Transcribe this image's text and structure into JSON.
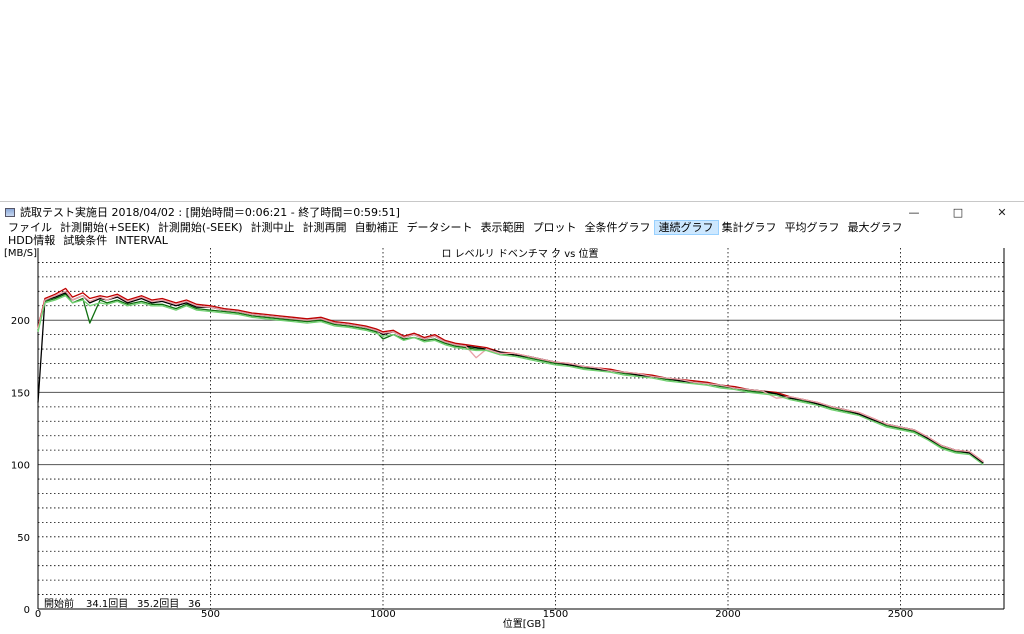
{
  "window": {
    "title": "読取テスト実施日 2018/04/02 : [開始時間＝0:06:21 - 終了時間＝0:59:51]",
    "controls": [
      "—",
      "□",
      "✕"
    ]
  },
  "icons": {
    "app": "app-window-icon",
    "minimize": "minimize-icon",
    "maximize": "maximize-icon",
    "close": "close-icon"
  },
  "menu": {
    "row1": [
      "ファイル",
      "計測開始(+SEEK)",
      "計測開始(-SEEK)",
      "計測中止",
      "計測再開",
      "自動補正",
      "データシート",
      "表示範囲",
      "プロット",
      "全条件グラフ",
      "連続グラフ",
      "集計グラフ",
      "平均グラフ",
      "最大グラフ"
    ],
    "row2": [
      "HDD情報",
      "試験条件",
      "INTERVAL"
    ],
    "active_index": 10
  },
  "colors": {
    "accent": "#cde8ff",
    "grid": "#000000"
  },
  "chart_data": {
    "type": "line",
    "title": "ロ  レベルリ  ドベンチマ  ク vs 位置",
    "xlabel": "位置[GB]",
    "ylabel": "[MB/S]",
    "xlim": [
      0,
      2800
    ],
    "ylim": [
      0,
      250
    ],
    "x_ticks": [
      0,
      500,
      1000,
      1500,
      2000,
      2500
    ],
    "y_ticks": [
      0,
      50,
      100,
      150,
      200
    ],
    "y_tick_labels": [
      "0",
      "50",
      "100",
      "150",
      "200"
    ],
    "x_tick_labels": [
      "0",
      "500",
      "1000",
      "1500",
      "2000",
      "2500"
    ],
    "legend": [
      "開始前",
      "34.1回目",
      "35.2回目",
      "36"
    ],
    "grid": true,
    "series": [
      {
        "color": "#c00000",
        "x": [
          0,
          20,
          50,
          80,
          100,
          130,
          150,
          180,
          200,
          230,
          260,
          300,
          330,
          360,
          400,
          430,
          460,
          500,
          540,
          580,
          620,
          660,
          700,
          740,
          780,
          820,
          860,
          900,
          950,
          980,
          1000,
          1030,
          1060,
          1090,
          1120,
          1150,
          1180,
          1210,
          1240,
          1270,
          1300,
          1340,
          1380,
          1420,
          1460,
          1500,
          1540,
          1580,
          1620,
          1660,
          1700,
          1740,
          1780,
          1820,
          1860,
          1900,
          1940,
          1980,
          2020,
          2060,
          2100,
          2140,
          2180,
          2220,
          2260,
          2300,
          2340,
          2380,
          2420,
          2460,
          2500,
          2540,
          2580,
          2620,
          2660,
          2700,
          2740
        ],
        "y": [
          195,
          215,
          218,
          222,
          216,
          219,
          215,
          217,
          216,
          218,
          214,
          217,
          214,
          215,
          212,
          214,
          211,
          210,
          208,
          207,
          205,
          204,
          203,
          202,
          201,
          202,
          199,
          198,
          196,
          194,
          192,
          193,
          189,
          191,
          188,
          190,
          186,
          184,
          183,
          182,
          181,
          178,
          177,
          175,
          173,
          171,
          170,
          168,
          167,
          166,
          164,
          163,
          162,
          160,
          159,
          158,
          157,
          155,
          154,
          152,
          151,
          150,
          147,
          145,
          143,
          140,
          138,
          136,
          132,
          128,
          126,
          124,
          119,
          113,
          110,
          109,
          102
        ]
      },
      {
        "color": "#107010",
        "x": [
          0,
          20,
          50,
          80,
          100,
          130,
          150,
          180,
          200,
          230,
          260,
          300,
          330,
          360,
          400,
          430,
          460,
          500,
          540,
          580,
          620,
          660,
          700,
          740,
          780,
          820,
          860,
          900,
          950,
          980,
          1000,
          1030,
          1060,
          1090,
          1120,
          1150,
          1180,
          1210,
          1240,
          1270,
          1300,
          1340,
          1380,
          1420,
          1460,
          1500,
          1540,
          1580,
          1620,
          1660,
          1700,
          1740,
          1780,
          1820,
          1860,
          1900,
          1940,
          1980,
          2020,
          2060,
          2100,
          2140,
          2180,
          2220,
          2260,
          2300,
          2340,
          2380,
          2420,
          2460,
          2500,
          2540,
          2580,
          2620,
          2660,
          2700,
          2740
        ],
        "y": [
          193,
          213,
          215,
          218,
          212,
          215,
          198,
          214,
          212,
          214,
          211,
          213,
          211,
          211,
          208,
          211,
          208,
          207,
          206,
          205,
          203,
          202,
          201,
          200,
          199,
          200,
          197,
          196,
          194,
          192,
          187,
          190,
          187,
          188,
          186,
          187,
          184,
          182,
          181,
          180,
          180,
          177,
          176,
          174,
          172,
          170,
          169,
          167,
          166,
          165,
          163,
          162,
          161,
          159,
          158,
          157,
          156,
          154,
          153,
          151,
          150,
          149,
          146,
          144,
          142,
          139,
          137,
          135,
          131,
          127,
          125,
          123,
          118,
          112,
          109,
          108,
          101
        ]
      },
      {
        "color": "#000000",
        "x": [
          0,
          20,
          50,
          80,
          100,
          130,
          150,
          180,
          200,
          230,
          260,
          300,
          330,
          360,
          400,
          430,
          460,
          500,
          540,
          580,
          620,
          660,
          700,
          740,
          780,
          820,
          860,
          900,
          950,
          980,
          1000,
          1030,
          1060,
          1090,
          1120,
          1150,
          1180,
          1210,
          1240,
          1270,
          1300,
          1340,
          1380,
          1420,
          1460,
          1500,
          1540,
          1580,
          1620,
          1660,
          1700,
          1740,
          1780,
          1820,
          1860,
          1900,
          1940,
          1980,
          2020,
          2060,
          2100,
          2140,
          2180,
          2220,
          2260,
          2300,
          2340,
          2380,
          2420,
          2460,
          2500,
          2540,
          2580,
          2620,
          2660,
          2700,
          2740
        ],
        "y": [
          143,
          214,
          216,
          219,
          214,
          217,
          212,
          215,
          214,
          216,
          212,
          215,
          212,
          213,
          210,
          212,
          209,
          209,
          207,
          206,
          204,
          203,
          202,
          201,
          200,
          201,
          198,
          197,
          195,
          193,
          190,
          192,
          188,
          190,
          187,
          189,
          185,
          183,
          182,
          181,
          180,
          178,
          176,
          175,
          173,
          171,
          169,
          168,
          166,
          165,
          164,
          162,
          161,
          160,
          158,
          157,
          156,
          155,
          153,
          152,
          151,
          149,
          146,
          145,
          142,
          140,
          138,
          135,
          131,
          128,
          126,
          124,
          118,
          113,
          110,
          108,
          101
        ]
      },
      {
        "color": "#e8a0a8",
        "x": [
          0,
          20,
          50,
          80,
          100,
          130,
          150,
          180,
          200,
          230,
          260,
          300,
          330,
          360,
          400,
          430,
          460,
          500,
          540,
          580,
          620,
          660,
          700,
          740,
          780,
          820,
          860,
          900,
          950,
          980,
          1000,
          1030,
          1060,
          1090,
          1120,
          1150,
          1180,
          1210,
          1240,
          1270,
          1300,
          1340,
          1380,
          1420,
          1460,
          1500,
          1540,
          1580,
          1620,
          1660,
          1700,
          1740,
          1780,
          1820,
          1860,
          1900,
          1940,
          1980,
          2020,
          2060,
          2100,
          2140,
          2180,
          2220,
          2260,
          2300,
          2340,
          2380,
          2420,
          2460,
          2500,
          2540,
          2580,
          2620,
          2660,
          2700,
          2740
        ],
        "y": [
          194,
          214,
          217,
          220,
          214,
          217,
          213,
          216,
          214,
          217,
          213,
          216,
          213,
          214,
          211,
          213,
          210,
          209,
          207,
          206,
          204,
          203,
          202,
          201,
          200,
          201,
          198,
          197,
          195,
          193,
          191,
          192,
          188,
          190,
          187,
          189,
          185,
          183,
          182,
          174,
          180,
          177,
          177,
          175,
          173,
          171,
          170,
          168,
          167,
          165,
          164,
          163,
          161,
          160,
          159,
          157,
          156,
          155,
          153,
          152,
          151,
          146,
          147,
          145,
          143,
          140,
          138,
          136,
          132,
          128,
          126,
          124,
          119,
          113,
          110,
          109,
          102
        ]
      },
      {
        "color": "#70d070",
        "x": [
          0,
          20,
          50,
          80,
          100,
          130,
          150,
          180,
          200,
          230,
          260,
          300,
          330,
          360,
          400,
          430,
          460,
          500,
          540,
          580,
          620,
          660,
          700,
          740,
          780,
          820,
          860,
          900,
          950,
          980,
          1000,
          1030,
          1060,
          1090,
          1120,
          1150,
          1180,
          1210,
          1240,
          1270,
          1300,
          1340,
          1380,
          1420,
          1460,
          1500,
          1540,
          1580,
          1620,
          1660,
          1700,
          1740,
          1780,
          1820,
          1860,
          1900,
          1940,
          1980,
          2020,
          2060,
          2100,
          2140,
          2180,
          2220,
          2260,
          2300,
          2340,
          2380,
          2420,
          2460,
          2500,
          2540,
          2580,
          2620,
          2660,
          2700,
          2740
        ],
        "y": [
          192,
          212,
          214,
          217,
          212,
          214,
          210,
          212,
          211,
          213,
          210,
          212,
          210,
          210,
          207,
          210,
          207,
          206,
          205,
          204,
          202,
          201,
          200,
          199,
          198,
          199,
          196,
          195,
          193,
          191,
          189,
          190,
          186,
          188,
          185,
          186,
          183,
          181,
          180,
          179,
          179,
          176,
          175,
          173,
          171,
          169,
          168,
          166,
          165,
          164,
          162,
          161,
          160,
          158,
          157,
          156,
          155,
          153,
          152,
          150,
          149,
          148,
          145,
          143,
          141,
          138,
          136,
          134,
          130,
          126,
          124,
          122,
          117,
          111,
          108,
          107,
          100
        ]
      }
    ]
  }
}
